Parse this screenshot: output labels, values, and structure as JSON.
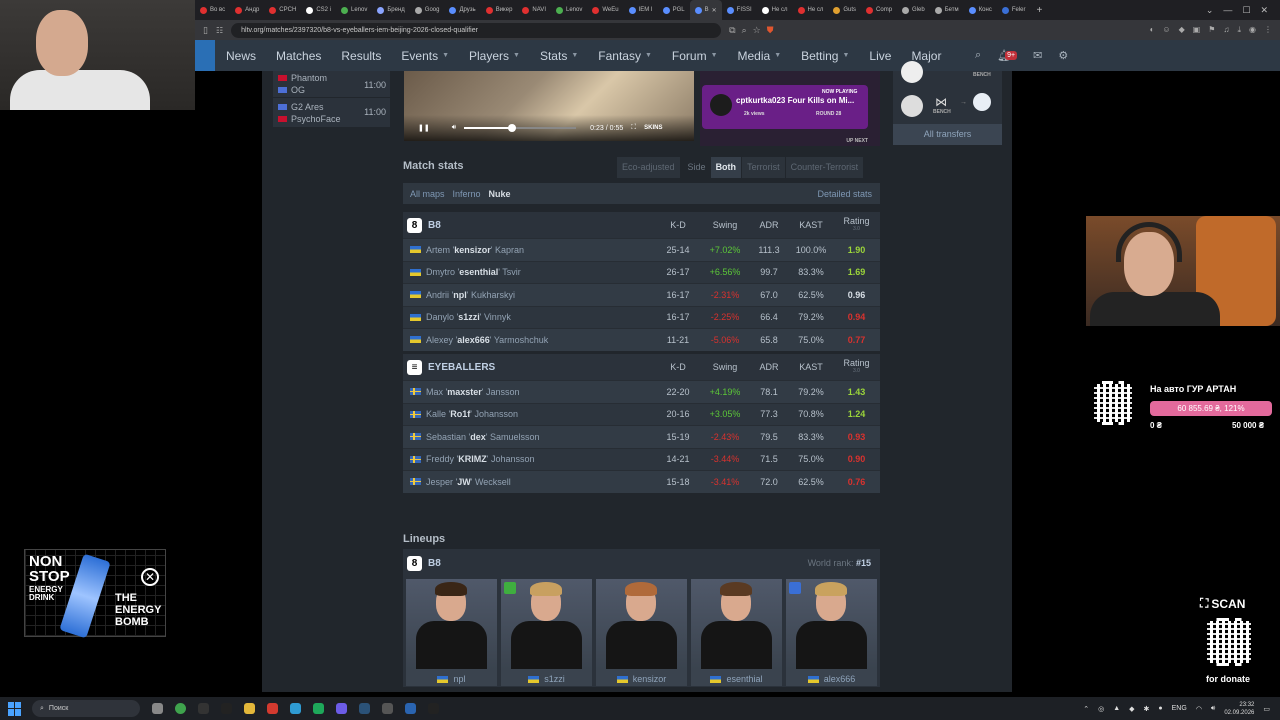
{
  "browser": {
    "tabs": [
      {
        "label": "Во вс",
        "color": "#e03030"
      },
      {
        "label": "Андр",
        "color": "#e03030"
      },
      {
        "label": "CPCH",
        "color": "#e03030"
      },
      {
        "label": "CS2 i",
        "color": "#ffffff"
      },
      {
        "label": "Lenov",
        "color": "#4caf50"
      },
      {
        "label": "Бренд",
        "color": "#8aa4ff"
      },
      {
        "label": "Goog",
        "color": "#aaaaaa"
      },
      {
        "label": "Друзь",
        "color": "#5a8eff"
      },
      {
        "label": "Викер",
        "color": "#e03030"
      },
      {
        "label": "NAVI",
        "color": "#e03030"
      },
      {
        "label": "Lenov",
        "color": "#4caf50"
      },
      {
        "label": "WeEu",
        "color": "#e03030"
      },
      {
        "label": "IEM I",
        "color": "#5a8eff"
      },
      {
        "label": "PGL",
        "color": "#5a8eff"
      },
      {
        "label": "B",
        "color": "#5a8eff",
        "active": true
      },
      {
        "label": "FISSI",
        "color": "#5a8eff"
      },
      {
        "label": "Не сл",
        "color": "#ffffff"
      },
      {
        "label": "Не сл",
        "color": "#e03030"
      },
      {
        "label": "Guts",
        "color": "#e0a030"
      },
      {
        "label": "Comp",
        "color": "#e03030"
      },
      {
        "label": "Gleb",
        "color": "#aaaaaa"
      },
      {
        "label": "Бетм",
        "color": "#aaaaaa"
      },
      {
        "label": "Конс",
        "color": "#5a8eff"
      },
      {
        "label": "Feler",
        "color": "#3a6fd6"
      }
    ],
    "url": "hltv.org/matches/2397320/b8-vs-eyeballers-iem-beijing-2026-closed-qualifier"
  },
  "nav": {
    "items": [
      {
        "label": "News",
        "caret": false
      },
      {
        "label": "Matches",
        "caret": false
      },
      {
        "label": "Results",
        "caret": false
      },
      {
        "label": "Events",
        "caret": true
      },
      {
        "label": "Players",
        "caret": true
      },
      {
        "label": "Stats",
        "caret": true
      },
      {
        "label": "Fantasy",
        "caret": true
      },
      {
        "label": "Forum",
        "caret": true
      },
      {
        "label": "Media",
        "caret": true
      },
      {
        "label": "Betting",
        "caret": true
      },
      {
        "label": "Live",
        "caret": false
      },
      {
        "label": "Major",
        "caret": false
      }
    ],
    "notification_badge": "9+"
  },
  "upcoming": [
    {
      "team1": "Phantom",
      "team2": "OG",
      "time": "11:00",
      "flag1": "#c8102e",
      "flag2": "#4d6fd6"
    },
    {
      "team1": "G2 Ares",
      "team2": "PsychoFace",
      "time": "11:00",
      "flag1": "#4d6fd6",
      "flag2": "#c8102e"
    }
  ],
  "video": {
    "time": "0:23 / 0:55",
    "progress": 0.42,
    "brand": "SKINS"
  },
  "now_playing": {
    "tag": "NOW PLAYING",
    "title": "cptkurtka023 Four Kills on Mi...",
    "views": "2k views",
    "round": "ROUND 28",
    "up_next": "UP NEXT"
  },
  "transfers": {
    "status1": "BENCH",
    "status2": "BENCH",
    "all_label": "All transfers"
  },
  "match_stats": {
    "title": "Match stats",
    "eco_label": "Eco-adjusted",
    "side_label": "Side",
    "sides": [
      "Both",
      "Terrorist",
      "Counter-Terrorist"
    ],
    "maps": [
      {
        "label": "All maps",
        "active": false
      },
      {
        "label": "Inferno",
        "active": false
      },
      {
        "label": "Nuke",
        "active": true
      }
    ],
    "detailed_label": "Detailed stats",
    "columns": {
      "kd": "K-D",
      "swing": "Swing",
      "adr": "ADR",
      "kast": "KAST",
      "rating": "Rating",
      "rating_ver": "3.0"
    },
    "teams": [
      {
        "name": "B8",
        "logo": "8",
        "players": [
          {
            "first": "Artem",
            "nick": "kensizor",
            "last": "Kapran",
            "flag": "ua",
            "kd": "25-14",
            "swing": "+7.02%",
            "adr": "111.3",
            "kast": "100.0%",
            "rating": "1.90",
            "rating_class": "hi",
            "swing_class": "pos"
          },
          {
            "first": "Dmytro",
            "nick": "esenthial",
            "last": "Tsvir",
            "flag": "ua",
            "kd": "26-17",
            "swing": "+6.56%",
            "adr": "99.7",
            "kast": "83.3%",
            "rating": "1.69",
            "rating_class": "hi",
            "swing_class": "pos"
          },
          {
            "first": "Andrii",
            "nick": "npl",
            "last": "Kukharskyi",
            "flag": "ua",
            "kd": "16-17",
            "swing": "-2.31%",
            "adr": "67.0",
            "kast": "62.5%",
            "rating": "0.96",
            "rating_class": "mid",
            "swing_class": "neg"
          },
          {
            "first": "Danylo",
            "nick": "s1zzi",
            "last": "Vinnyk",
            "flag": "ua",
            "kd": "16-17",
            "swing": "-2.25%",
            "adr": "66.4",
            "kast": "79.2%",
            "rating": "0.94",
            "rating_class": "lo",
            "swing_class": "neg"
          },
          {
            "first": "Alexey",
            "nick": "alex666",
            "last": "Yarmoshchuk",
            "flag": "ua",
            "kd": "11-21",
            "swing": "-5.06%",
            "adr": "65.8",
            "kast": "75.0%",
            "rating": "0.77",
            "rating_class": "lo",
            "swing_class": "neg"
          }
        ]
      },
      {
        "name": "EYEBALLERS",
        "logo": "≡",
        "players": [
          {
            "first": "Max",
            "nick": "maxster",
            "last": "Jansson",
            "flag": "se",
            "kd": "22-20",
            "swing": "+4.19%",
            "adr": "78.1",
            "kast": "79.2%",
            "rating": "1.43",
            "rating_class": "hi",
            "swing_class": "pos"
          },
          {
            "first": "Kalle",
            "nick": "Ro1f",
            "last": "Johansson",
            "flag": "se",
            "kd": "20-16",
            "swing": "+3.05%",
            "adr": "77.3",
            "kast": "70.8%",
            "rating": "1.24",
            "rating_class": "hi",
            "swing_class": "pos"
          },
          {
            "first": "Sebastian",
            "nick": "dex",
            "last": "Samuelsson",
            "flag": "se",
            "kd": "15-19",
            "swing": "-2.43%",
            "adr": "79.5",
            "kast": "83.3%",
            "rating": "0.93",
            "rating_class": "lo",
            "swing_class": "neg"
          },
          {
            "first": "Freddy",
            "nick": "KRIMZ",
            "last": "Johansson",
            "flag": "se",
            "kd": "14-21",
            "swing": "-3.44%",
            "adr": "71.5",
            "kast": "75.0%",
            "rating": "0.90",
            "rating_class": "lo",
            "swing_class": "neg"
          },
          {
            "first": "Jesper",
            "nick": "JW",
            "last": "Wecksell",
            "flag": "se",
            "kd": "15-18",
            "swing": "-3.41%",
            "adr": "72.0",
            "kast": "62.5%",
            "rating": "0.76",
            "rating_class": "lo",
            "swing_class": "neg"
          }
        ]
      }
    ]
  },
  "lineups": {
    "title": "Lineups",
    "team": "B8",
    "world_rank_label": "World rank:",
    "world_rank": "#15",
    "players": [
      {
        "nick": "npl",
        "badge": ""
      },
      {
        "nick": "s1zzi",
        "badge": "#3fae3f"
      },
      {
        "nick": "kensizor",
        "badge": ""
      },
      {
        "nick": "esenthial",
        "badge": ""
      },
      {
        "nick": "alex666",
        "badge": "#3a6fd6"
      }
    ]
  },
  "overlay": {
    "donate_title": "На авто ГУР АРТАН",
    "donate_progress": "60 855.69 ₴, 121%",
    "donate_min": "0 ₴",
    "donate_max": "50 000 ₴",
    "ad_line1": "NON",
    "ad_line2": "STOP",
    "ad_line3": "ENERGY DRINK",
    "ad_line4": "THE ENERGY BOMB",
    "scan_label": "SCAN",
    "scan_note": "for donate"
  },
  "taskbar": {
    "search_placeholder": "Поиск",
    "lang": "ENG",
    "time": "23:32",
    "date": "02.09.2026"
  }
}
